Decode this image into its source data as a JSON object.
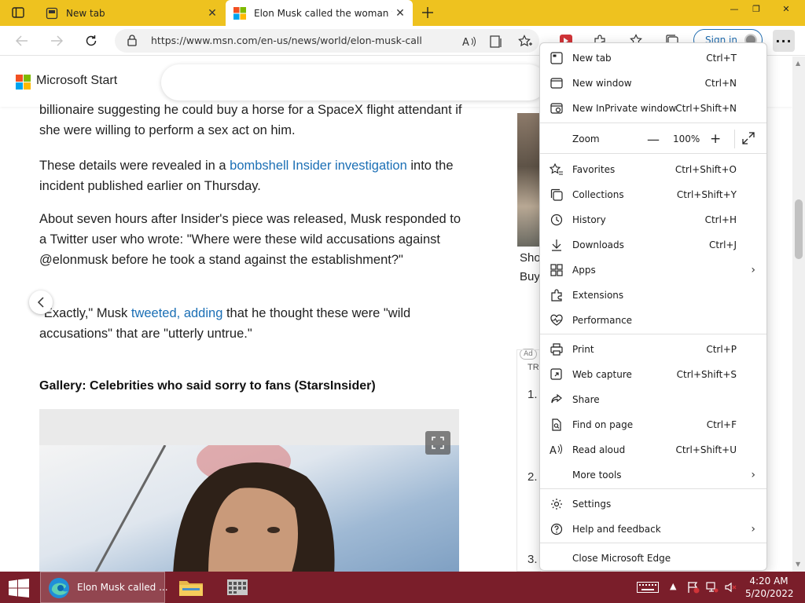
{
  "browser": {
    "tabs": [
      {
        "title": "New tab",
        "active": false
      },
      {
        "title": "Elon Musk called the woman wh",
        "active": true
      }
    ],
    "address": "https://www.msn.com/en-us/news/world/elon-musk-called-t...",
    "sign_in": "Sign in"
  },
  "site": {
    "logo_text": "Microsoft Start"
  },
  "article": {
    "p0": "billionaire suggesting he could buy a horse for a SpaceX flight attendant if she were willing to perform a sex act on him.",
    "p1_pre": "These details were revealed in a ",
    "p1_link": "bombshell Insider investigation",
    "p1_post": " into the incident published earlier on Thursday.",
    "p2": "About seven hours after Insider's piece was released, Musk responded to a Twitter user who wrote: \"Where were these wild accusations against @elonmusk before he took a stand against the establishment?\"",
    "p3_pre": "\"Exactly,\" Musk ",
    "p3_link": "tweeted, adding",
    "p3_post": " that he thought these were \"wild accusations\" that are \"utterly untrue.\"",
    "gallery_title": "Gallery: Celebrities who said sorry to fans (StarsInsider)"
  },
  "sidebar": {
    "line1": "Sho",
    "line2": "Buy",
    "ad": "Ad",
    "trending": "TR",
    "nums": [
      "1.",
      "2.",
      "3."
    ]
  },
  "menu": {
    "items": [
      {
        "label": "New tab",
        "shortcut": "Ctrl+T"
      },
      {
        "label": "New window",
        "shortcut": "Ctrl+N"
      },
      {
        "label": "New InPrivate window",
        "shortcut": "Ctrl+Shift+N"
      },
      {
        "label": "Zoom",
        "shortcut": ""
      },
      {
        "label": "Favorites",
        "shortcut": "Ctrl+Shift+O"
      },
      {
        "label": "Collections",
        "shortcut": "Ctrl+Shift+Y"
      },
      {
        "label": "History",
        "shortcut": "Ctrl+H"
      },
      {
        "label": "Downloads",
        "shortcut": "Ctrl+J"
      },
      {
        "label": "Apps",
        "shortcut": ""
      },
      {
        "label": "Extensions",
        "shortcut": ""
      },
      {
        "label": "Performance",
        "shortcut": ""
      },
      {
        "label": "Print",
        "shortcut": "Ctrl+P"
      },
      {
        "label": "Web capture",
        "shortcut": "Ctrl+Shift+S"
      },
      {
        "label": "Share",
        "shortcut": ""
      },
      {
        "label": "Find on page",
        "shortcut": "Ctrl+F"
      },
      {
        "label": "Read aloud",
        "shortcut": "Ctrl+Shift+U"
      },
      {
        "label": "More tools",
        "shortcut": ""
      },
      {
        "label": "Settings",
        "shortcut": ""
      },
      {
        "label": "Help and feedback",
        "shortcut": ""
      },
      {
        "label": "Close Microsoft Edge",
        "shortcut": ""
      }
    ],
    "zoom": {
      "minus": "—",
      "value": "100%",
      "plus": "+"
    }
  },
  "taskbar": {
    "app_label": "Elon Musk called ...",
    "time": "4:20 AM",
    "date": "5/20/2022"
  },
  "colors": {
    "tabbar": "#eec21f",
    "link": "#1b6fb5",
    "taskbar": "#7a1e2a"
  }
}
